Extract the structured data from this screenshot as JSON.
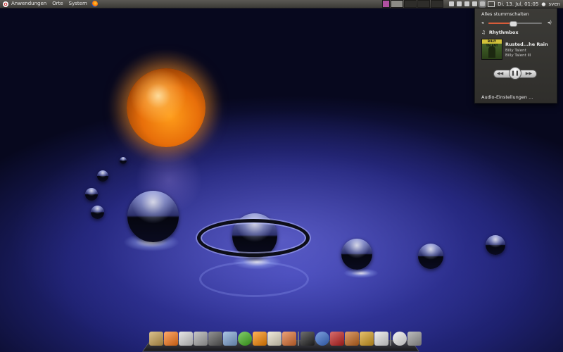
{
  "top_panel": {
    "menus": [
      "Anwendungen",
      "Orte",
      "System"
    ],
    "datetime": "Di. 13. Jul, 01:05",
    "user": "sven"
  },
  "sound_menu": {
    "mute_label": "Alles stummschalten",
    "volume_fraction": 0.45,
    "player_name": "Rhythmbox",
    "album_art_text": "BILLY TALENT",
    "track_title": "Rusted...he Rain",
    "track_artist": "Billy Talent",
    "track_album": "Billy Talent III",
    "settings_label": "Audio-Einstellungen ..."
  },
  "dock": {
    "items": [
      {
        "name": "home-folder-icon",
        "color": "#c8a050"
      },
      {
        "name": "firefox-icon",
        "color": "#ff7a1a"
      },
      {
        "name": "mail-icon",
        "color": "#d8d8d8"
      },
      {
        "name": "drive-icon",
        "color": "#a9a9a9"
      },
      {
        "name": "terminal-pen-icon",
        "color": "#5a5a5a"
      },
      {
        "name": "notes-icon",
        "color": "#7fa5d6"
      },
      {
        "name": "media-player-icon",
        "color": "#43b51f"
      },
      {
        "name": "vlc-icon",
        "color": "#ff8a00"
      },
      {
        "name": "file-manager-icon",
        "color": "#e8e0c8"
      },
      {
        "name": "photo-icon",
        "color": "#e07030"
      },
      {
        "name": "terminal-icon",
        "color": "#222"
      },
      {
        "name": "globe-icon",
        "color": "#3a6fcf"
      },
      {
        "name": "filezilla-icon",
        "color": "#c3201f"
      },
      {
        "name": "package-icon",
        "color": "#c96a1e"
      },
      {
        "name": "badge-icon",
        "color": "#d8a020"
      },
      {
        "name": "ipod-icon",
        "color": "#e6e6e6"
      },
      {
        "name": "clock-icon",
        "color": "#eeeeee"
      },
      {
        "name": "trash-icon",
        "color": "#9a9a9a"
      }
    ]
  }
}
